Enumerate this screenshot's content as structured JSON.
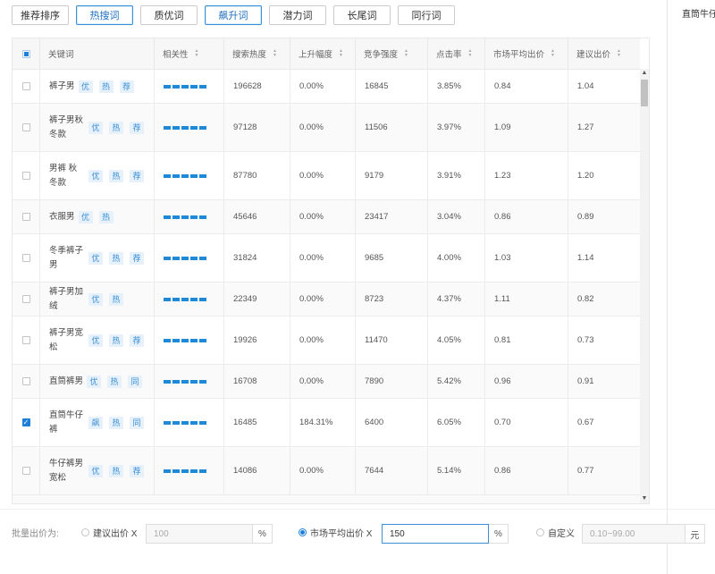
{
  "tabs": [
    {
      "label": "推荐排序",
      "active": false
    },
    {
      "label": "热搜词",
      "active": true
    },
    {
      "label": "质优词",
      "active": false
    },
    {
      "label": "飙升词",
      "active": true
    },
    {
      "label": "潜力词",
      "active": false
    },
    {
      "label": "长尾词",
      "active": false
    },
    {
      "label": "同行词",
      "active": false
    }
  ],
  "side_panel": {
    "text": "直筒牛仔"
  },
  "table": {
    "headers": [
      "关键词",
      "相关性",
      "搜索热度",
      "上升幅度",
      "竞争强度",
      "点击率",
      "市场平均出价",
      "建议出价"
    ],
    "sort_icon": "sort-updown-icon",
    "relevance_level": 5,
    "rows": [
      {
        "keyword": "裤子男",
        "tags": [
          "优",
          "热",
          "荐"
        ],
        "search_heat": "196628",
        "rise": "0.00%",
        "competition": "16845",
        "ctr": "3.85%",
        "market_avg_bid": "0.84",
        "suggested_bid": "1.04",
        "checked": false
      },
      {
        "keyword": "裤子男秋冬款",
        "tags": [
          "优",
          "热",
          "荐"
        ],
        "search_heat": "97128",
        "rise": "0.00%",
        "competition": "11506",
        "ctr": "3.97%",
        "market_avg_bid": "1.09",
        "suggested_bid": "1.27",
        "checked": false
      },
      {
        "keyword": "男裤 秋冬款",
        "tags": [
          "优",
          "热",
          "荐"
        ],
        "search_heat": "87780",
        "rise": "0.00%",
        "competition": "9179",
        "ctr": "3.91%",
        "market_avg_bid": "1.23",
        "suggested_bid": "1.20",
        "checked": false
      },
      {
        "keyword": "衣服男",
        "tags": [
          "优",
          "热"
        ],
        "search_heat": "45646",
        "rise": "0.00%",
        "competition": "23417",
        "ctr": "3.04%",
        "market_avg_bid": "0.86",
        "suggested_bid": "0.89",
        "checked": false
      },
      {
        "keyword": "冬季裤子男",
        "tags": [
          "优",
          "热",
          "荐"
        ],
        "search_heat": "31824",
        "rise": "0.00%",
        "competition": "9685",
        "ctr": "4.00%",
        "market_avg_bid": "1.03",
        "suggested_bid": "1.14",
        "checked": false
      },
      {
        "keyword": "裤子男加绒",
        "tags": [
          "优",
          "热"
        ],
        "search_heat": "22349",
        "rise": "0.00%",
        "competition": "8723",
        "ctr": "4.37%",
        "market_avg_bid": "1.11",
        "suggested_bid": "0.82",
        "checked": false
      },
      {
        "keyword": "裤子男宽松",
        "tags": [
          "优",
          "热",
          "荐"
        ],
        "search_heat": "19926",
        "rise": "0.00%",
        "competition": "11470",
        "ctr": "4.05%",
        "market_avg_bid": "0.81",
        "suggested_bid": "0.73",
        "checked": false
      },
      {
        "keyword": "直筒裤男",
        "tags": [
          "优",
          "热",
          "同"
        ],
        "search_heat": "16708",
        "rise": "0.00%",
        "competition": "7890",
        "ctr": "5.42%",
        "market_avg_bid": "0.96",
        "suggested_bid": "0.91",
        "checked": false
      },
      {
        "keyword": "直筒牛仔裤",
        "tags": [
          "飙",
          "热",
          "同"
        ],
        "search_heat": "16485",
        "rise": "184.31%",
        "competition": "6400",
        "ctr": "6.05%",
        "market_avg_bid": "0.70",
        "suggested_bid": "0.67",
        "checked": true
      },
      {
        "keyword": "牛仔裤男宽松",
        "tags": [
          "优",
          "热",
          "荐"
        ],
        "search_heat": "14086",
        "rise": "0.00%",
        "competition": "7644",
        "ctr": "5.14%",
        "market_avg_bid": "0.86",
        "suggested_bid": "0.77",
        "checked": false
      }
    ]
  },
  "batch_bid": {
    "label": "批量出价为:",
    "option_suggested": {
      "label": "建议出价 X",
      "value": "100",
      "unit": "%",
      "selected": false
    },
    "option_market": {
      "label": "市场平均出价 X",
      "value": "150",
      "unit": "%",
      "selected": true
    },
    "option_custom": {
      "label": "自定义",
      "placeholder": "0.10~99.00",
      "unit": "元",
      "selected": false
    }
  },
  "colors": {
    "accent": "#1e7fd6",
    "relevance_bar": "#1e88d9",
    "tag_bg": "#e6f1fb",
    "tag_text": "#3a8fd6"
  }
}
